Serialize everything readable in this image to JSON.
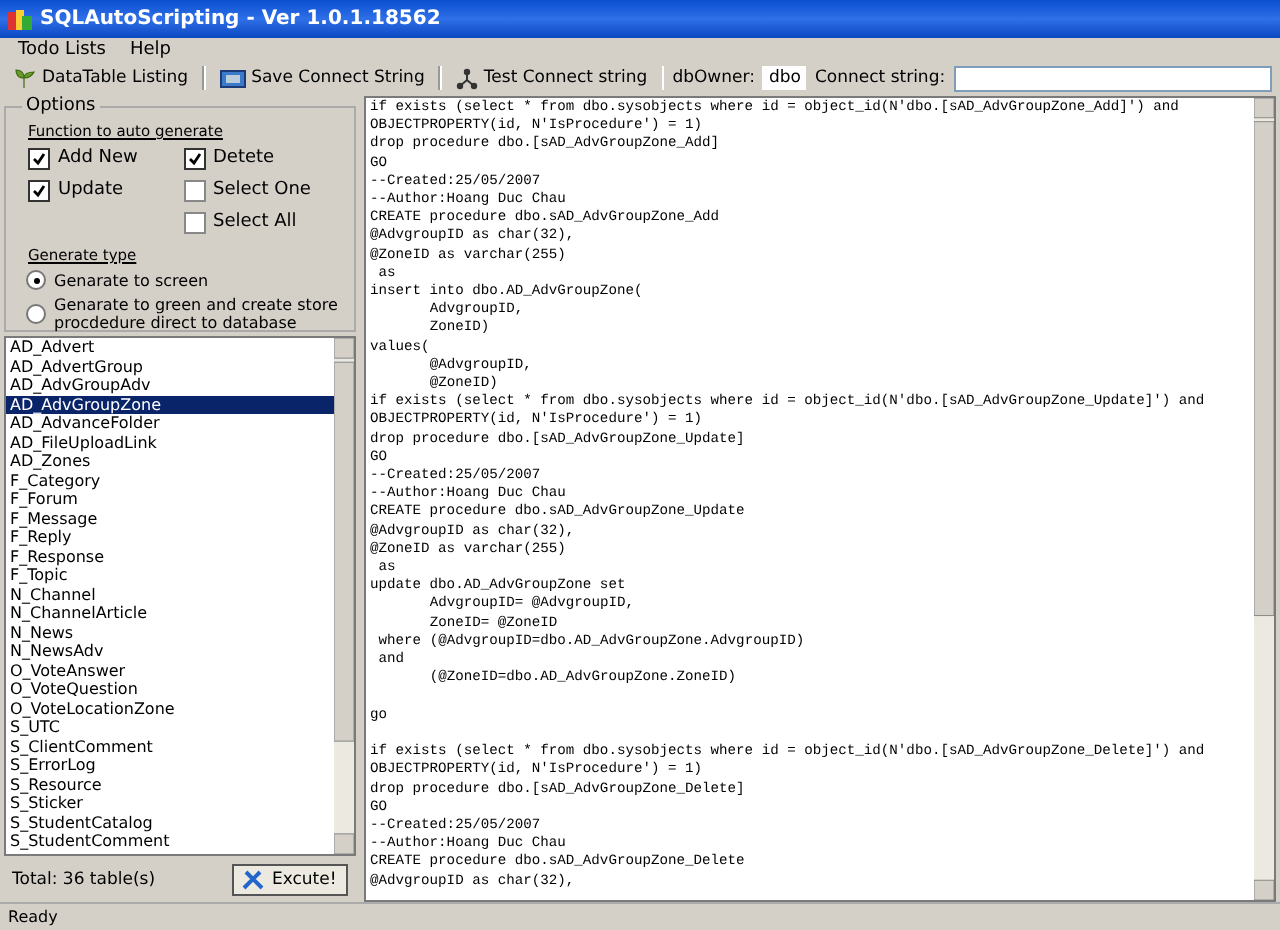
{
  "window": {
    "title": "SQLAutoScripting - Ver 1.0.1.18562"
  },
  "menu": [
    "Todo Lists",
    "Help"
  ],
  "toolbar": {
    "buttons": [
      {
        "kind": "table",
        "label": "DataTable Listing"
      },
      {
        "kind": "save",
        "label": "Save Connect String"
      },
      {
        "kind": "network",
        "label": "Test Connect string"
      }
    ],
    "db_owner": {
      "label": "dbOwner:",
      "value": "dbo"
    },
    "connect_string": {
      "label": "Connect string:"
    }
  },
  "options": {
    "title": "Options",
    "function_heading": "Function to auto generate",
    "function_columns": [
      {
        "items": [
          {
            "label": "Add New",
            "checked": true
          },
          {
            "label": "Update",
            "checked": true
          }
        ]
      },
      {
        "items": [
          {
            "label": "Detete",
            "checked": true
          },
          {
            "label": "Select One",
            "checked": false
          },
          {
            "label": "Select All",
            "checked": false
          }
        ]
      }
    ],
    "type_heading": "Generate type",
    "types": [
      {
        "label": "Genarate to screen",
        "selected": true
      },
      {
        "label": "Genarate to  green and create store procdedure direct to database",
        "selected": false
      }
    ]
  },
  "tables": [
    {
      "name": "AD_Advert",
      "selected": false
    },
    {
      "name": "AD_AdvertGroup",
      "selected": false
    },
    {
      "name": "AD_AdvGroupAdv",
      "selected": false
    },
    {
      "name": "AD_AdvGroupZone",
      "selected": true
    },
    {
      "name": "AD_AdvanceFolder",
      "selected": false
    },
    {
      "name": "AD_FileUploadLink",
      "selected": false
    },
    {
      "name": "AD_Zones",
      "selected": false
    },
    {
      "name": "F_Category",
      "selected": false
    },
    {
      "name": "F_Forum",
      "selected": false
    },
    {
      "name": "F_Message",
      "selected": false
    },
    {
      "name": "F_Reply",
      "selected": false
    },
    {
      "name": "F_Response",
      "selected": false
    },
    {
      "name": "F_Topic",
      "selected": false
    },
    {
      "name": "N_Channel",
      "selected": false
    },
    {
      "name": "N_ChannelArticle",
      "selected": false
    },
    {
      "name": "N_News",
      "selected": false
    },
    {
      "name": "N_NewsAdv",
      "selected": false
    },
    {
      "name": "O_VoteAnswer",
      "selected": false
    },
    {
      "name": "O_VoteQuestion",
      "selected": false
    },
    {
      "name": "O_VoteLocationZone",
      "selected": false
    },
    {
      "name": "S_UTC",
      "selected": false
    },
    {
      "name": "S_ClientComment",
      "selected": false
    },
    {
      "name": "S_ErrorLog",
      "selected": false
    },
    {
      "name": "S_Resource",
      "selected": false
    },
    {
      "name": "S_Sticker",
      "selected": false
    },
    {
      "name": "S_StudentCatalog",
      "selected": false
    },
    {
      "name": "S_StudentComment",
      "selected": false
    }
  ],
  "total": "Total: 36 table(s)",
  "execute_button": "Excute!",
  "script": "if exists (select * from dbo.sysobjects where id = object_id(N'dbo.[sAD_AdvGroupZone_Add]') and\nOBJECTPROPERTY(id, N'IsProcedure') = 1)\ndrop procedure dbo.[sAD_AdvGroupZone_Add]\nGO\n--Created:25/05/2007\n--Author:Hoang Duc Chau\nCREATE procedure dbo.sAD_AdvGroupZone_Add\n@AdvgroupID as char(32),\n@ZoneID as varchar(255)\n as\ninsert into dbo.AD_AdvGroupZone(\n\tAdvgroupID,\n\tZoneID)\nvalues(\n\t@AdvgroupID,\n\t@ZoneID)\nif exists (select * from dbo.sysobjects where id = object_id(N'dbo.[sAD_AdvGroupZone_Update]') and\nOBJECTPROPERTY(id, N'IsProcedure') = 1)\ndrop procedure dbo.[sAD_AdvGroupZone_Update]\nGO\n--Created:25/05/2007\n--Author:Hoang Duc Chau\nCREATE procedure dbo.sAD_AdvGroupZone_Update\n@AdvgroupID as char(32),\n@ZoneID as varchar(255)\n as\nupdate dbo.AD_AdvGroupZone set\n\tAdvgroupID= @AdvgroupID,\n\tZoneID= @ZoneID\n where\t(@AdvgroupID=dbo.AD_AdvGroupZone.AdvgroupID)\n and\n\t(@ZoneID=dbo.AD_AdvGroupZone.ZoneID)\n\ngo\n\nif exists (select * from dbo.sysobjects where id = object_id(N'dbo.[sAD_AdvGroupZone_Delete]') and\nOBJECTPROPERTY(id, N'IsProcedure') = 1)\ndrop procedure dbo.[sAD_AdvGroupZone_Delete]\nGO\n--Created:25/05/2007\n--Author:Hoang Duc Chau\nCREATE procedure dbo.sAD_AdvGroupZone_Delete\n@AdvgroupID as char(32),",
  "status_bar": "Ready"
}
